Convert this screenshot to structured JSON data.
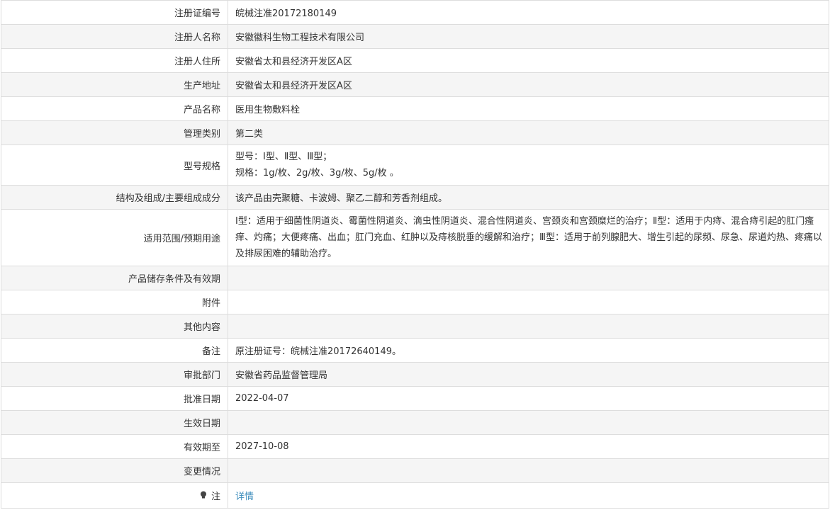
{
  "rows": [
    {
      "label": "注册证编号",
      "value": "皖械注准20172180149"
    },
    {
      "label": "注册人名称",
      "value": "安徽徽科生物工程技术有限公司"
    },
    {
      "label": "注册人住所",
      "value": "安徽省太和县经济开发区A区"
    },
    {
      "label": "生产地址",
      "value": "安徽省太和县经济开发区A区"
    },
    {
      "label": "产品名称",
      "value": "医用生物敷料栓"
    },
    {
      "label": "管理类别",
      "value": "第二类"
    },
    {
      "label": "型号规格",
      "lines": [
        "型号：Ⅰ型、Ⅱ型、Ⅲ型；",
        "规格：1g/枚、2g/枚、3g/枚、5g/枚 。"
      ]
    },
    {
      "label": "结构及组成/主要组成成分",
      "value": "该产品由壳聚糖、卡波姆、聚乙二醇和芳香剂组成。"
    },
    {
      "label": "适用范围/预期用途",
      "value": "I型：适用于细菌性阴道炎、霉菌性阴道炎、滴虫性阴道炎、混合性阴道炎、宫颈炎和宫颈糜烂的治疗；Ⅱ型：适用于内痔、混合痔引起的肛门瘙痒、灼痛；大便疼痛、出血；肛门充血、红肿以及痔核脱垂的缓解和治疗；Ⅲ型：适用于前列腺肥大、增生引起的尿频、尿急、尿道灼热、疼痛以及排尿困难的辅助治疗。"
    },
    {
      "label": "产品储存条件及有效期",
      "value": ""
    },
    {
      "label": "附件",
      "value": ""
    },
    {
      "label": "其他内容",
      "value": ""
    },
    {
      "label": "备注",
      "value": "原注册证号：皖械注准20172640149。"
    },
    {
      "label": "审批部门",
      "value": "安徽省药品监督管理局"
    },
    {
      "label": "批准日期",
      "value": "2022-04-07"
    },
    {
      "label": "生效日期",
      "value": ""
    },
    {
      "label": "有效期至",
      "value": "2027-10-08"
    },
    {
      "label": "变更情况",
      "value": ""
    },
    {
      "label": "注",
      "value": "详情",
      "icon": "lightbulb-icon"
    }
  ]
}
